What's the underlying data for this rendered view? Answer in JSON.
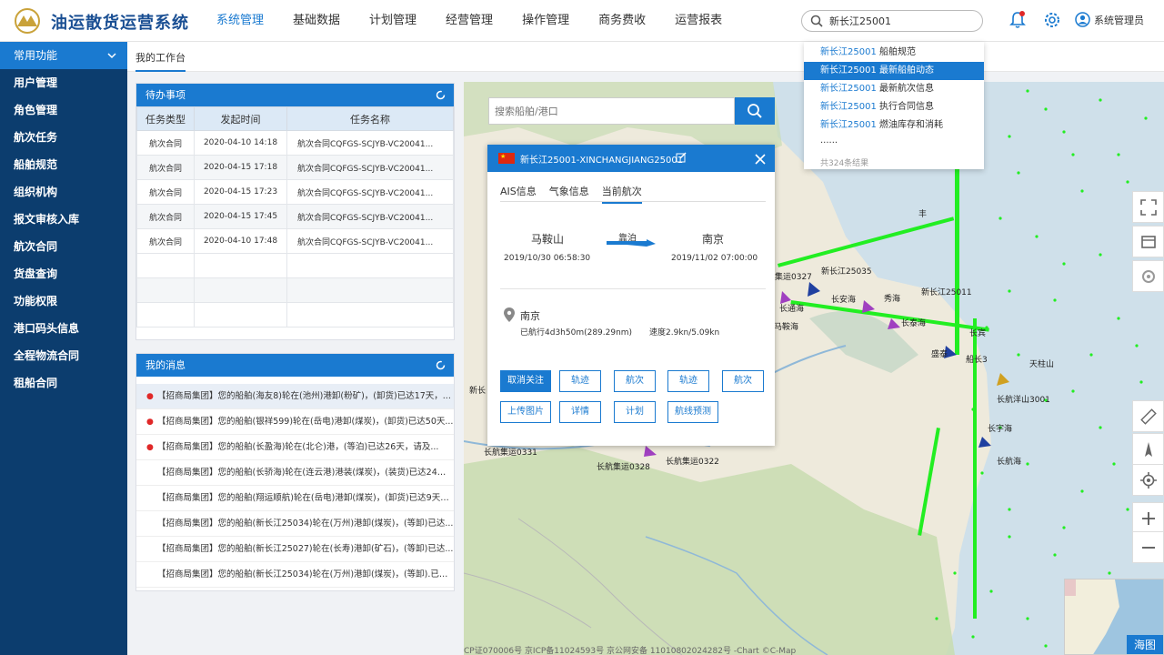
{
  "header": {
    "title": "油运散货运营系统",
    "nav": [
      "系统管理",
      "基础数据",
      "计划管理",
      "经营管理",
      "操作管理",
      "商务费收",
      "运营报表"
    ],
    "search_value": "新长江25001",
    "user": "系统管理员",
    "bell_badge": "1"
  },
  "search_dropdown": {
    "items": [
      {
        "kw": "新长江25001",
        "text": "船舶规范"
      },
      {
        "kw": "新长江25001",
        "text": "最新船舶动态"
      },
      {
        "kw": "新长江25001",
        "text": "最新航次信息"
      },
      {
        "kw": "新长江25001",
        "text": "执行合同信息"
      },
      {
        "kw": "新长江25001",
        "text": "燃油库存和消耗"
      }
    ],
    "more": "......",
    "total": "共324条结果"
  },
  "sidebar": {
    "header": "常用功能",
    "items": [
      "用户管理",
      "角色管理",
      "航次任务",
      "船舶规范",
      "组织机构",
      "报文审核入库",
      "航次合同",
      "货盘查询",
      "功能权限",
      "港口码头信息",
      "全程物流合同",
      "租船合同"
    ]
  },
  "workspace": {
    "tab": "我的工作台"
  },
  "todo": {
    "title": "待办事项",
    "columns": [
      "任务类型",
      "发起时间",
      "任务名称"
    ],
    "rows": [
      [
        "航次合同",
        "2020-04-10  14:18",
        "航次合同CQFGS-SCJYB-VC20041..."
      ],
      [
        "航次合同",
        "2020-04-15  17:18",
        "航次合同CQFGS-SCJYB-VC20041..."
      ],
      [
        "航次合同",
        "2020-04-15  17:23",
        "航次合同CQFGS-SCJYB-VC20041..."
      ],
      [
        "航次合同",
        "2020-04-15  17:45",
        "航次合同CQFGS-SCJYB-VC20041..."
      ],
      [
        "航次合同",
        "2020-04-10  17:48",
        "航次合同CQFGS-SCJYB-VC20041..."
      ]
    ]
  },
  "messages": {
    "title": "我的消息",
    "items": [
      {
        "unread": true,
        "text": "【招商局集团】您的船舶(海友8)轮在(池州)港卸(粉矿)，(卸货)已达17天，..."
      },
      {
        "unread": true,
        "text": "【招商局集团】您的船舶(银祥599)轮在(岳电)港卸(煤炭)，(卸货)已达50天..."
      },
      {
        "unread": true,
        "text": "【招商局集团】您的船舶(长盈海)轮在(北仑)港，(等泊)已达26天，请及..."
      },
      {
        "unread": false,
        "text": "【招商局集团】您的船舶(长骄海)轮在(连云港)港装(煤炭)，(装货)已达24天..."
      },
      {
        "unread": false,
        "text": "【招商局集团】您的船舶(翔运顺航)轮在(岳电)港卸(煤炭)，(卸货)已达9天，..."
      },
      {
        "unread": false,
        "text": "【招商局集团】您的船舶(新长江25034)轮在(万州)港卸(煤炭)，(等卸)已达..."
      },
      {
        "unread": false,
        "text": "【招商局集团】您的船舶(新长江25027)轮在(长寿)港卸(矿石)，(等卸)已达..."
      },
      {
        "unread": false,
        "text": "【招商局集团】您的船舶(新长江25034)轮在(万州)港卸(煤炭)，(等卸).已达..."
      }
    ]
  },
  "map": {
    "search_placeholder": "搜索船舶/港口",
    "minimap_label": "海图",
    "copyright": "CP证070006号  京ICP备11024593号  京公网安备 11010802024282号  -Chart ©C-Map",
    "labels": [
      {
        "t": "新长江25035"
      },
      {
        "t": "新长江25011"
      },
      {
        "t": "长航集运0331"
      },
      {
        "t": "长航集运0328"
      },
      {
        "t": "长航集运0322"
      },
      {
        "t": "长航洋山3001"
      },
      {
        "t": "长安海"
      },
      {
        "t": "长通海"
      },
      {
        "t": "长泰海"
      },
      {
        "t": "长宇海"
      },
      {
        "t": "长航海"
      },
      {
        "t": "天柱山"
      },
      {
        "t": "船长3"
      },
      {
        "t": "长宾"
      },
      {
        "t": "新长"
      },
      {
        "t": "集运0327"
      },
      {
        "t": "秀海"
      },
      {
        "t": "盛泰"
      },
      {
        "t": "马鞍海"
      },
      {
        "t": "丰"
      }
    ]
  },
  "popup": {
    "title": "新长江25001-XINCHANGJIANG25001",
    "tabs": [
      "AIS信息",
      "气象信息",
      "当前航次"
    ],
    "from_port": "马鞍山",
    "from_time": "2019/10/30   06:58:30",
    "status": "靠泊",
    "to_port": "南京",
    "to_time": "2019/11/02   07:00:00",
    "current_port": "南京",
    "sailed": "已航行4d3h50m(289.29nm)",
    "speed": "速度2.9kn/5.09kn",
    "buttons_row1": [
      "取消关注",
      "轨迹",
      "航次",
      "轨迹",
      "航次"
    ],
    "buttons_row2": [
      "上传图片",
      "详情",
      "计划",
      "航线预测"
    ]
  },
  "colors": {
    "primary": "#1a7ad0",
    "sidebar": "#0c3d6e",
    "ship_dot": "#22ee22",
    "unread": "#e02828"
  }
}
